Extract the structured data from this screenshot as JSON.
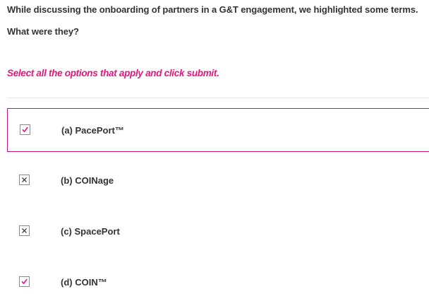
{
  "question": {
    "line1": "While discussing the onboarding of partners in a G&T engagement, we highlighted some terms.",
    "line2": "What were they?"
  },
  "instruction": "Select all the options that apply and click submit.",
  "options": [
    {
      "label": "(a) PacePort™",
      "mark": "check-icon",
      "selected": true
    },
    {
      "label": "(b) COINage",
      "mark": "cross-icon",
      "selected": false
    },
    {
      "label": "(c) SpacePort",
      "mark": "cross-icon",
      "selected": false
    },
    {
      "label": "(d) COIN™",
      "mark": "check-icon",
      "selected": false
    }
  ],
  "colors": {
    "accent": "#e3177e",
    "selected_border": "#c2187a",
    "check": "#e3177e",
    "cross": "#333333",
    "text": "#333333"
  }
}
